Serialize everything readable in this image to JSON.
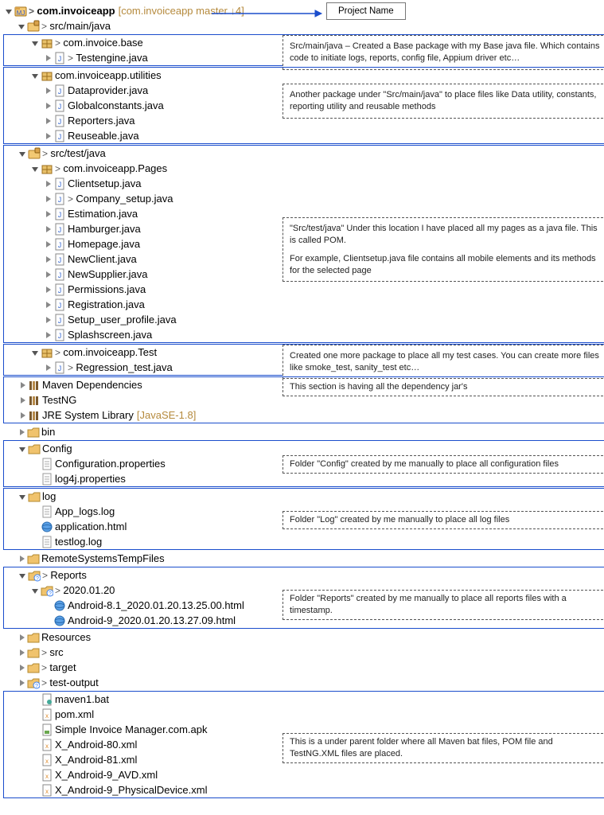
{
  "root": {
    "name": "com.invoiceapp",
    "git": "[com.invoiceapp master ↓4]"
  },
  "ann": {
    "projectName": "Project Name",
    "basePkg": "Src/main/java – Created a Base package with my Base java file. Which contains code to initiate logs, reports, config file, Appium driver etc…",
    "utilPkg": "Another package under \"Src/main/java\" to place files like Data utility, constants, reporting utility and reusable methods",
    "pagesPkg1": "\"Src/test/java\" Under this location I have placed all my pages as a java file. This is called POM.",
    "pagesPkg2": "For example, Clientsetup.java file contains all mobile elements and its methods for the selected page",
    "testPkg": "Created one more package to place all my test cases. You can create more files like smoke_test, sanity_test etc…",
    "deps": "This section is having all the dependency jar's",
    "config": "Folder \"Config\" created by me manually to place all configuration files",
    "log": "Folder \"Log\" created by me manually to place all log files",
    "reports": "Folder \"Reports\" created by me manually to place all reports files with a timestamp.",
    "rootFiles": "This is a under parent folder where all Maven bat files, POM file and TestNG.XML files are placed."
  },
  "srcMain": {
    "folder": "src/main/java",
    "base": {
      "pkg": "com.invoice.base",
      "files": [
        "Testengine.java"
      ]
    },
    "util": {
      "pkg": "com.invoiceapp.utilities",
      "files": [
        "Dataprovider.java",
        "Globalconstants.java",
        "Reporters.java",
        "Reuseable.java"
      ]
    }
  },
  "srcTest": {
    "folder": "src/test/java",
    "pages": {
      "pkg": "com.invoiceapp.Pages",
      "files": [
        "Clientsetup.java",
        "Company_setup.java",
        "Estimation.java",
        "Hamburger.java",
        "Homepage.java",
        "NewClient.java",
        "NewSupplier.java",
        "Permissions.java",
        "Registration.java",
        "Setup_user_profile.java",
        "Splashscreen.java"
      ],
      "dirty": [
        "Company_setup.java"
      ]
    },
    "test": {
      "pkg": "com.invoiceapp.Test",
      "files": [
        "Regression_test.java"
      ]
    }
  },
  "libs": {
    "maven": "Maven Dependencies",
    "testng": "TestNG",
    "jre": "JRE System Library",
    "jreDecor": "[JavaSE-1.8]"
  },
  "folders": {
    "bin": "bin",
    "config": {
      "name": "Config",
      "files": [
        "Configuration.properties",
        "log4j.properties"
      ]
    },
    "log": {
      "name": "log",
      "files": [
        "App_logs.log",
        "application.html",
        "testlog.log"
      ]
    },
    "remote": "RemoteSystemsTempFiles",
    "reports": {
      "name": "Reports",
      "date": "2020.01.20",
      "files": [
        "Android-8.1_2020.01.20.13.25.00.html",
        "Android-9_2020.01.20.13.27.09.html"
      ]
    },
    "resources": "Resources",
    "src": "src",
    "target": "target",
    "testout": "test-output"
  },
  "rootFiles": [
    "maven1.bat",
    "pom.xml",
    "Simple Invoice Manager.com.apk",
    "X_Android-80.xml",
    "X_Android-81.xml",
    "X_Android-9_AVD.xml",
    "X_Android-9_PhysicalDevice.xml"
  ]
}
